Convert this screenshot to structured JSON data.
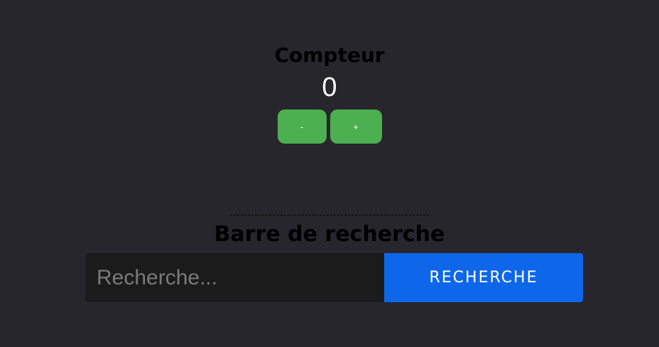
{
  "counter": {
    "title": "Compteur",
    "value": "0",
    "decrement_label": "-",
    "increment_label": "+"
  },
  "search": {
    "title": "Barre de recherche",
    "input_value": "",
    "placeholder": "Recherche...",
    "button_label": "RECHERCHE"
  },
  "colors": {
    "background": "#27262c",
    "counter_button": "#4caf50",
    "search_button": "#0e67ea",
    "search_input": "#1b1b1b"
  }
}
